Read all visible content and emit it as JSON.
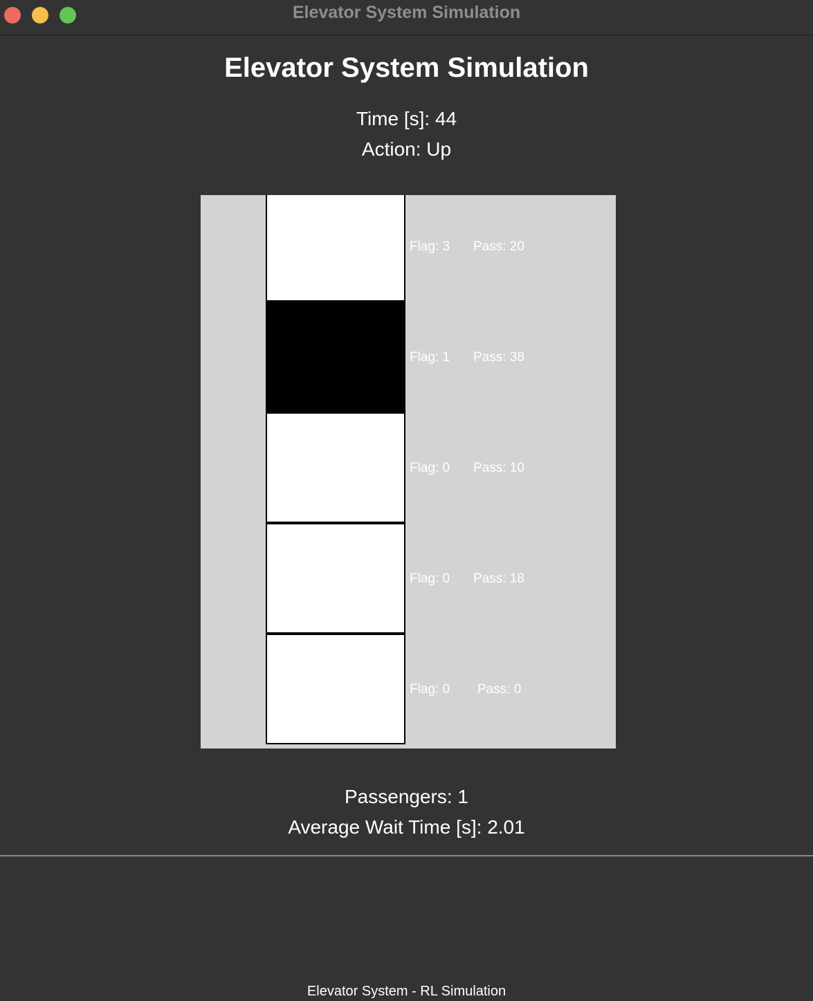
{
  "window": {
    "title": "Elevator System Simulation"
  },
  "header": {
    "title": "Elevator System Simulation",
    "time": "Time [s]: 44",
    "action": "Action: Up"
  },
  "floors": [
    {
      "flag": "Flag: 3",
      "pass": "Pass: 20",
      "occupied": false
    },
    {
      "flag": "Flag: 1",
      "pass": "Pass: 38",
      "occupied": true
    },
    {
      "flag": "Flag: 0",
      "pass": "Pass: 10",
      "occupied": false
    },
    {
      "flag": "Flag: 0",
      "pass": "Pass: 18",
      "occupied": false
    },
    {
      "flag": "Flag: 0",
      "pass": "Pass: 0",
      "occupied": false
    }
  ],
  "stats": {
    "passengers": "Passengers: 1",
    "avg_wait": "Average Wait Time [s]: 2.01"
  },
  "footer": {
    "text": "Elevator System - RL Simulation"
  },
  "colors": {
    "background": "#333333",
    "canvas": "#d3d3d3",
    "floor_empty": "#ffffff",
    "floor_elevator": "#000000",
    "close": "#ee6a5f",
    "minimize": "#f5be4f",
    "maximize": "#62c554"
  }
}
